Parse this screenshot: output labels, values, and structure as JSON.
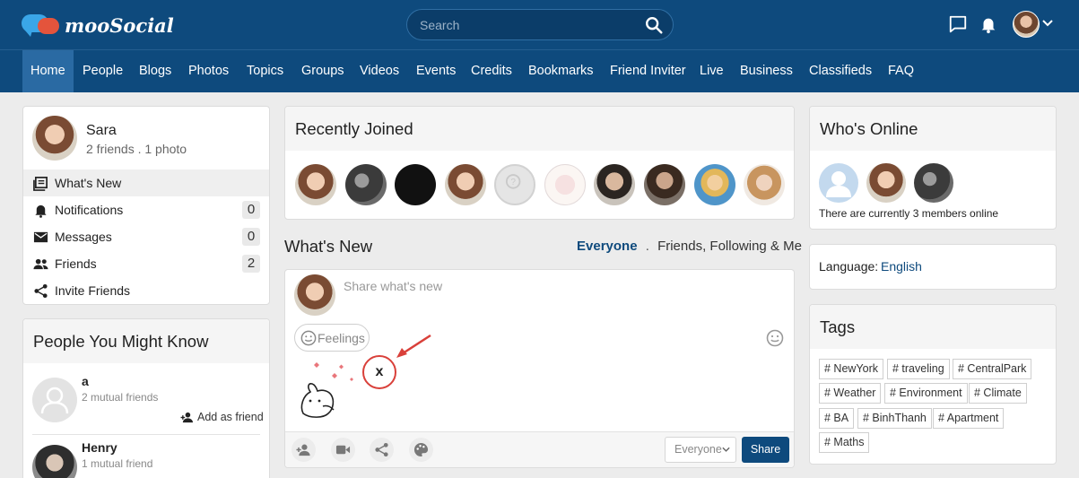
{
  "brand": {
    "name": "mooSocial"
  },
  "search": {
    "placeholder": "Search"
  },
  "nav": [
    "Home",
    "People",
    "Blogs",
    "Photos",
    "Topics",
    "Groups",
    "Videos",
    "Events",
    "Credits",
    "Bookmarks",
    "Friend Inviter",
    "Live",
    "Business",
    "Classifieds",
    "FAQ"
  ],
  "profile": {
    "name": "Sara",
    "stats": "2 friends . 1 photo",
    "menu": [
      {
        "label": "What's New",
        "icon": "news-icon"
      },
      {
        "label": "Notifications",
        "icon": "bell-icon",
        "count": "0"
      },
      {
        "label": "Messages",
        "icon": "mail-icon",
        "count": "0"
      },
      {
        "label": "Friends",
        "icon": "people-icon",
        "count": "2"
      },
      {
        "label": "Invite Friends",
        "icon": "share-icon"
      }
    ]
  },
  "pymk": {
    "title": "People You Might Know",
    "people": [
      {
        "name": "a",
        "mutual": "2 mutual friends",
        "action": "Add as friend"
      },
      {
        "name": "Henry",
        "mutual": "1 mutual friend"
      }
    ]
  },
  "recently_joined": {
    "title": "Recently Joined"
  },
  "whats_new": {
    "title": "What's New",
    "filter_active": "Everyone",
    "filter_sep": ".",
    "filter_other": "Friends, Following & Me"
  },
  "composer": {
    "placeholder": "Share what's new",
    "feelings_label": "Feelings",
    "remove_label": "x",
    "privacy": "Everyone",
    "share_label": "Share"
  },
  "whos_online": {
    "title": "Who's Online",
    "status": "There are currently 3 members online"
  },
  "language": {
    "label": "Language:",
    "value": "English"
  },
  "tags": {
    "title": "Tags",
    "items": [
      "# NewYork",
      "# traveling",
      "# CentralPark",
      "# Weather",
      "# Environment",
      "# Climate",
      "# BA",
      "# BinhThanh",
      "# Apartment",
      "# Maths"
    ]
  },
  "colors": {
    "brand": "#0e4a7d",
    "accent": "#0e4a7d",
    "annotation": "#d9403a"
  }
}
